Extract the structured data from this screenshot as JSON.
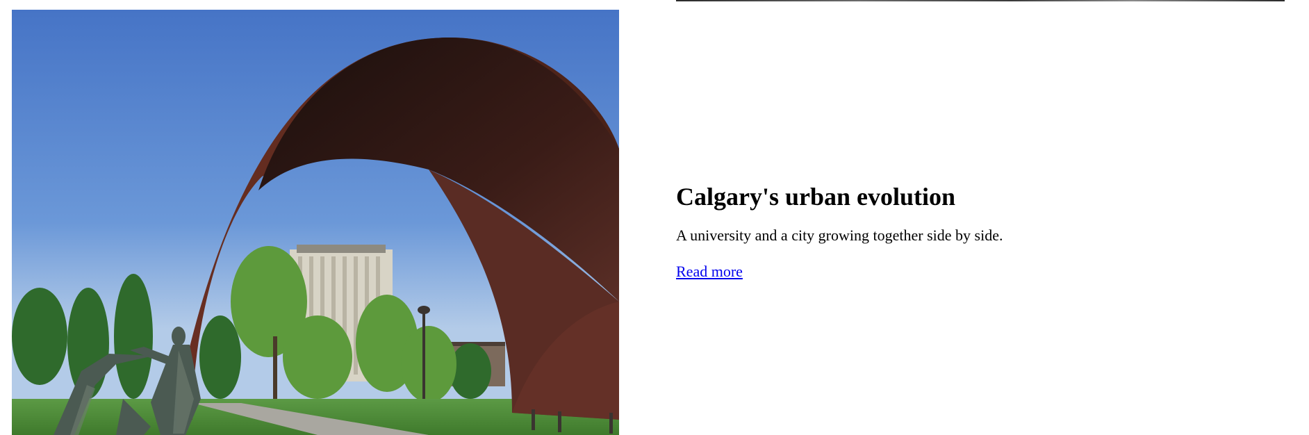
{
  "feature": {
    "image_alt": "Steel arch sculpture and bronze figures in front of a university tower",
    "title": "Calgary's urban evolution",
    "description": "A university and a city growing together side by side.",
    "link_label": "Read more"
  },
  "colors": {
    "link": "#0000ee",
    "sky": "#5a86cc",
    "arch": "#4a2620",
    "grass": "#4f8d3a"
  }
}
